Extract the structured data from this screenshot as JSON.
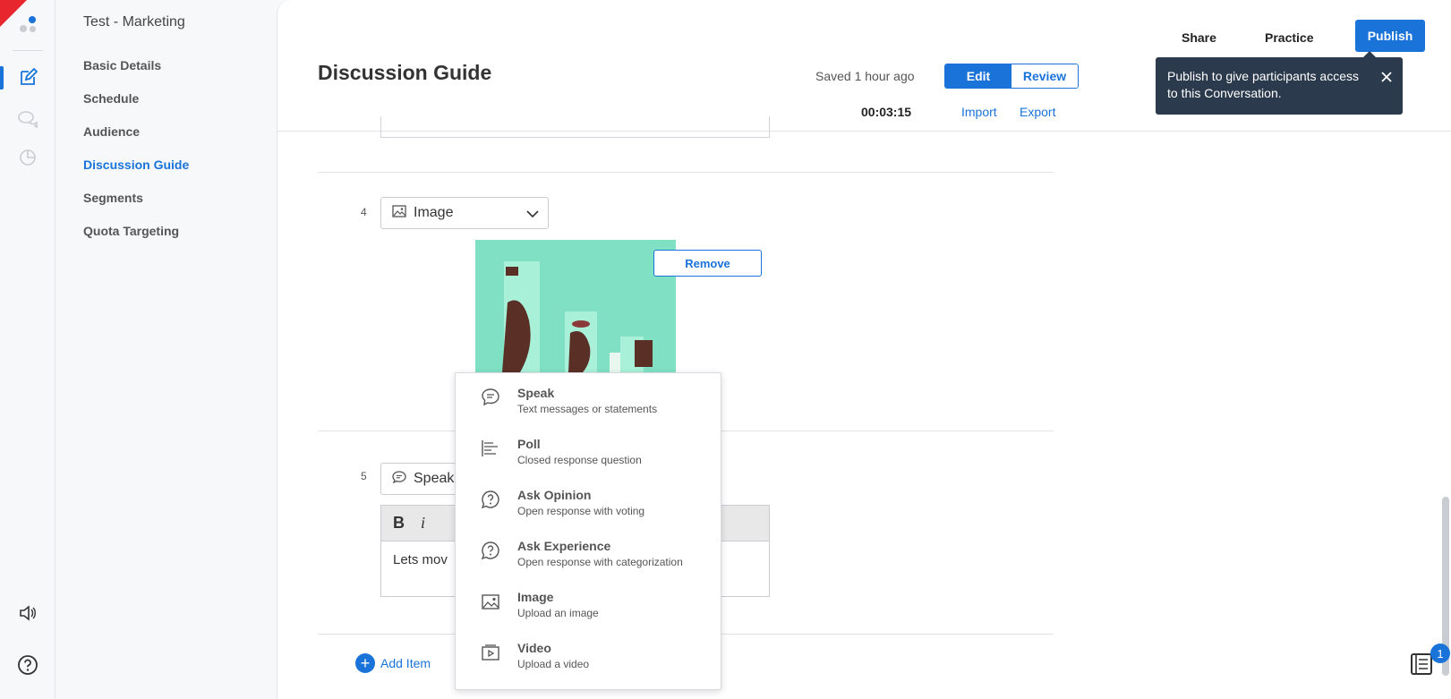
{
  "project": {
    "name": "Test - Marketing"
  },
  "nav": {
    "items": [
      {
        "label": "Basic Details",
        "active": false
      },
      {
        "label": "Schedule",
        "active": false
      },
      {
        "label": "Audience",
        "active": false
      },
      {
        "label": "Discussion Guide",
        "active": true
      },
      {
        "label": "Segments",
        "active": false
      },
      {
        "label": "Quota Targeting",
        "active": false
      }
    ]
  },
  "header": {
    "title": "Discussion Guide",
    "saved": "Saved 1 hour ago",
    "edit_label": "Edit",
    "review_label": "Review",
    "timer": "00:03:15",
    "import_label": "Import",
    "export_label": "Export"
  },
  "top_actions": {
    "share": "Share",
    "practice": "Practice",
    "publish": "Publish"
  },
  "tooltip": {
    "text": "Publish to give participants access to this Conversation."
  },
  "items": [
    {
      "number": "4",
      "type": "Image",
      "remove_label": "Remove"
    },
    {
      "number": "5",
      "type": "Speak",
      "bold": "B",
      "italic": "i",
      "text": "Lets mov"
    }
  ],
  "add_item_label": "Add Item",
  "notification_count": "1",
  "menu": {
    "options": [
      {
        "title": "Speak",
        "subtitle": "Text messages or statements",
        "icon": "speech-bubble-icon"
      },
      {
        "title": "Poll",
        "subtitle": "Closed response question",
        "icon": "poll-bars-icon"
      },
      {
        "title": "Ask Opinion",
        "subtitle": "Open response with voting",
        "icon": "question-bubble-icon"
      },
      {
        "title": "Ask Experience",
        "subtitle": "Open response with categorization",
        "icon": "question-bubble-icon"
      },
      {
        "title": "Image",
        "subtitle": "Upload an image",
        "icon": "image-icon"
      },
      {
        "title": "Video",
        "subtitle": "Upload a video",
        "icon": "video-icon"
      }
    ]
  },
  "colors": {
    "accent": "#1a73d9",
    "tooltip_bg": "#2b3a4d",
    "brand_red": "#e8262d",
    "image_bg": "#7fe0c4"
  }
}
